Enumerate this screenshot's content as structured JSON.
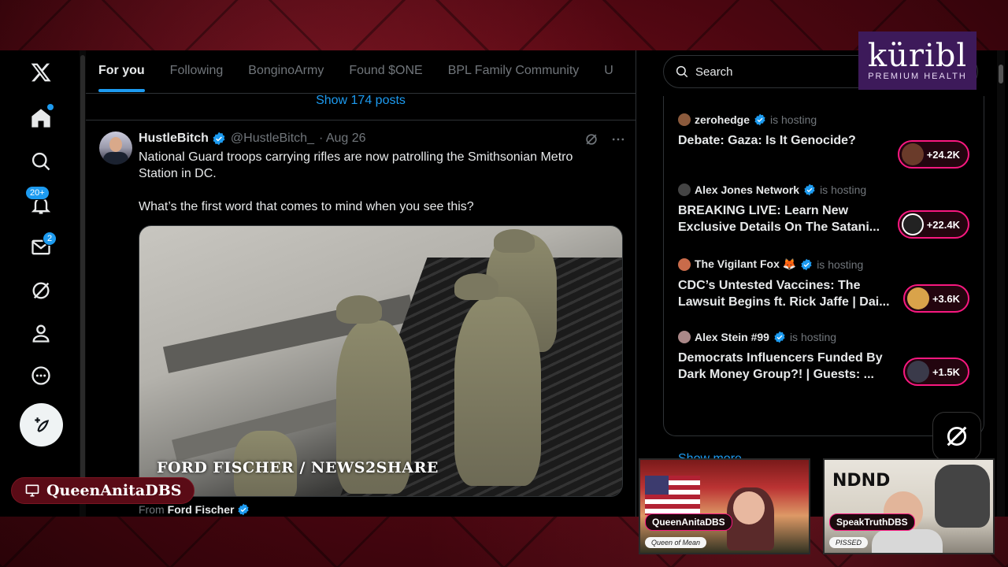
{
  "nav": {
    "logo": "x-logo",
    "items": [
      {
        "icon": "home-icon"
      },
      {
        "icon": "search-icon"
      },
      {
        "icon": "bell-icon",
        "badge": "20+"
      },
      {
        "icon": "mail-icon",
        "badge": "2"
      },
      {
        "icon": "grok-icon"
      },
      {
        "icon": "profile-icon"
      },
      {
        "icon": "more-icon"
      }
    ]
  },
  "tabs": [
    {
      "label": "For you",
      "active": true
    },
    {
      "label": "Following"
    },
    {
      "label": "BonginoArmy"
    },
    {
      "label": "Found $ONE"
    },
    {
      "label": "BPL Family Community"
    },
    {
      "label": "U"
    }
  ],
  "feed": {
    "show_posts": "Show 174 posts",
    "tweet": {
      "name": "HustleBitch",
      "handle": "@HustleBitch_",
      "date": "· Aug 26",
      "text1": "National Guard troops carrying rifles are now patrolling the Smithsonian Metro Station in DC.",
      "text2": "What’s the first word that comes to mind when you see this?",
      "media_caption": "FORD FISCHER / NEWS2SHARE",
      "from_prefix": "From",
      "from_name": "Ford Fischer"
    }
  },
  "search": {
    "placeholder": "Search"
  },
  "spaces": [
    {
      "host": "zerohedge",
      "hosting": "is hosting",
      "title": "Debate: Gaza: Is It Genocide?",
      "listeners": "+24.2K"
    },
    {
      "host": "Alex Jones Network",
      "hosting": "is hosting",
      "title": "BREAKING LIVE: Learn New Exclusive Details On The Satani...",
      "listeners": "+22.4K"
    },
    {
      "host": "The Vigilant Fox 🦊",
      "hosting": "is hosting",
      "title": "CDC’s Untested Vaccines: The Lawsuit Begins ft. Rick Jaffe | Dai...",
      "listeners": "+3.6K"
    },
    {
      "host": "Alex Stein #99",
      "hosting": "is hosting",
      "title": "Democrats Influencers Funded By Dark Money Group?! | Guests: ...",
      "listeners": "+1.5K"
    }
  ],
  "show_more": "Show more",
  "overlay": {
    "sponsor_brand": "küribl",
    "sponsor_tag": "PREMIUM HEALTH",
    "streamer_name": "QueenAnitaDBS",
    "cams": [
      {
        "label": "QueenAnitaDBS",
        "sub": "Queen of Mean"
      },
      {
        "label": "SpeakTruthDBS",
        "sub": "PISSED"
      }
    ]
  },
  "colors": {
    "accent": "#1d9bf0",
    "live_pink": "#f91880",
    "background": "#000000"
  }
}
